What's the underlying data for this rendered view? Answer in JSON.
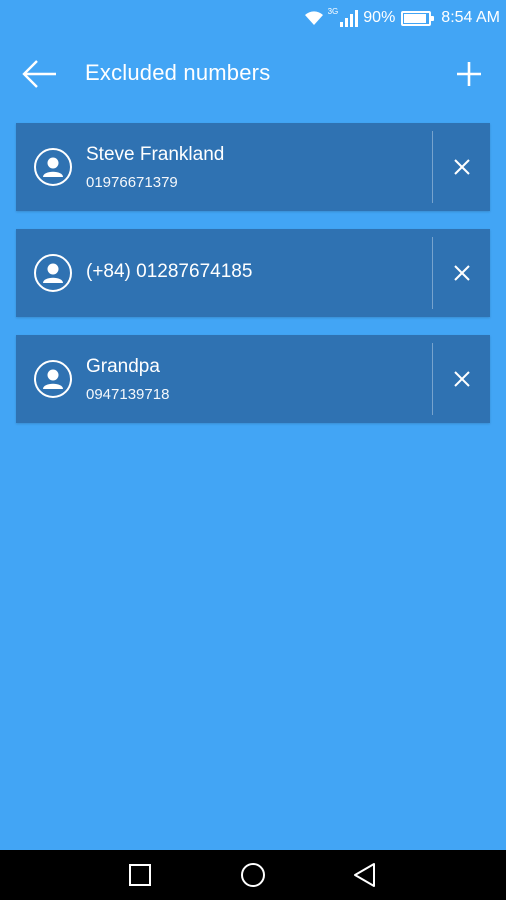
{
  "status_bar": {
    "network": "3G",
    "battery": "90%",
    "battery_level": 0.9,
    "time": "8:54 AM",
    "icons": [
      "wifi-icon",
      "signal-icon",
      "battery-icon"
    ]
  },
  "app_bar": {
    "title": "Excluded numbers",
    "back_icon": "arrow-left-icon",
    "add_icon": "plus-icon"
  },
  "contacts": [
    {
      "name": "Steve Frankland",
      "number": "01976671379"
    },
    {
      "name": "(+84) 01287674185",
      "number": ""
    },
    {
      "name": "Grandpa",
      "number": "0947139718"
    }
  ],
  "nav_bar": {
    "icons": [
      "recent-apps-icon",
      "home-icon",
      "back-triangle-icon"
    ]
  },
  "colors": {
    "background": "#42a5f5",
    "card": "#2f72b2",
    "text": "#ffffff",
    "nav_bar": "#000000"
  }
}
